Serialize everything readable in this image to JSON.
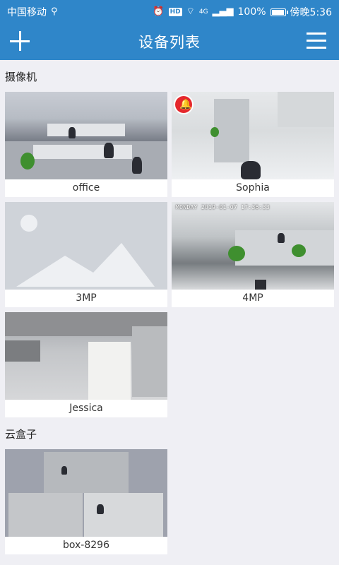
{
  "status_bar": {
    "carrier": "中国移动",
    "usb_icon": "usb-icon",
    "network_type": "4G",
    "battery_percent": "100%",
    "battery_level": 1.0,
    "time": "傍晚5:36"
  },
  "header": {
    "title": "设备列表",
    "add_icon": "plus-icon",
    "menu_icon": "hamburger-menu-icon"
  },
  "sections": [
    {
      "label": "摄像机",
      "devices": [
        {
          "name": "office",
          "thumbnail": "office-scene",
          "alarm": false
        },
        {
          "name": "Sophia",
          "thumbnail": "lobby-scene",
          "alarm": true
        },
        {
          "name": "3MP",
          "thumbnail": "placeholder",
          "alarm": false
        },
        {
          "name": "4MP",
          "thumbnail": "office-overhead-scene",
          "alarm": false,
          "osd_text": "MONDAY 2019-01-07 17:36:33"
        },
        {
          "name": "Jessica",
          "thumbnail": "sofa-room-scene",
          "alarm": false
        }
      ]
    },
    {
      "label": "云盒子",
      "devices": [
        {
          "name": "box-8296",
          "thumbnail": "multiview-scene",
          "alarm": false
        }
      ]
    }
  ],
  "colors": {
    "header_bg": "#2f86c9",
    "page_bg": "#efeff4",
    "alarm_red": "#e5282d"
  }
}
